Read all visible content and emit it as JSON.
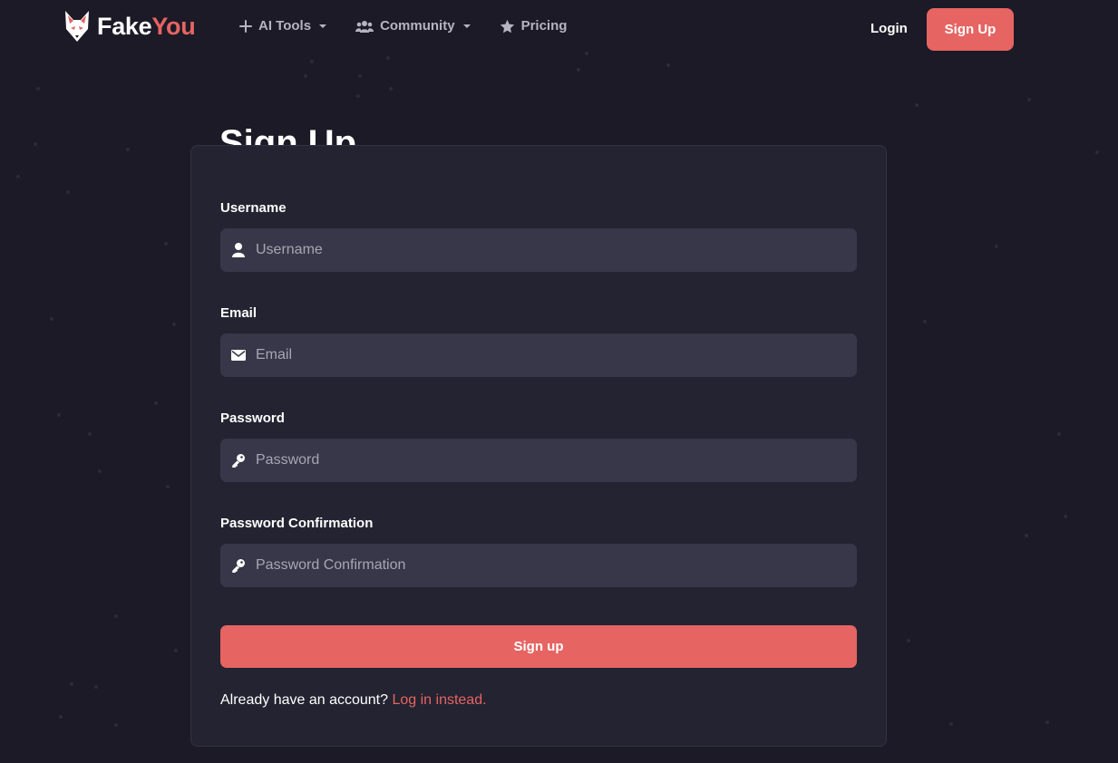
{
  "nav": {
    "logo_text_a": "Fake",
    "logo_text_b": "You",
    "items": [
      {
        "label": "AI Tools",
        "icon": "plus-icon",
        "dropdown": true
      },
      {
        "label": "Community",
        "icon": "users-icon",
        "dropdown": true
      },
      {
        "label": "Pricing",
        "icon": "star-icon",
        "dropdown": false
      }
    ],
    "login_label": "Login",
    "signup_label": "Sign Up"
  },
  "form": {
    "title": "Sign Up",
    "fields": [
      {
        "label": "Username",
        "placeholder": "Username",
        "value": "",
        "icon": "user-icon"
      },
      {
        "label": "Email",
        "placeholder": "Email",
        "value": "",
        "icon": "envelope-icon"
      },
      {
        "label": "Password",
        "placeholder": "Password",
        "value": "",
        "icon": "key-icon"
      },
      {
        "label": "Password Confirmation",
        "placeholder": "Password Confirmation",
        "value": "",
        "icon": "key-icon"
      }
    ],
    "submit_label": "Sign up",
    "login_prompt": "Already have an account?",
    "login_link": "Log in instead."
  },
  "colors": {
    "background": "#1b1a26",
    "card": "#242331",
    "input": "#383749",
    "accent": "#e66462"
  }
}
